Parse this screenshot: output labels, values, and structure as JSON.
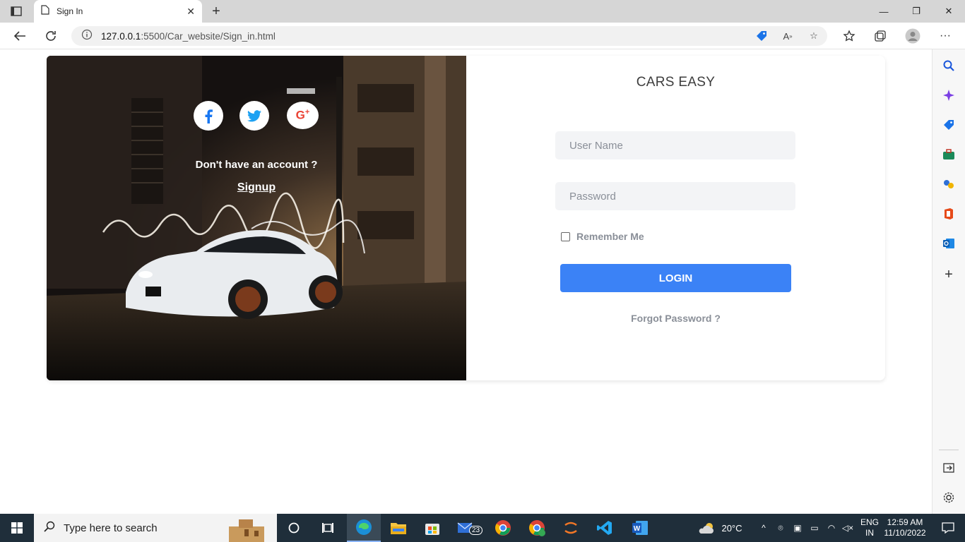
{
  "browser": {
    "tab_title": "Sign In",
    "url_host": "127.0.0.1",
    "url_path": ":5500/Car_website/Sign_in.html",
    "new_tab_label": "+"
  },
  "hero": {
    "no_account_text": "Don't have an account ?",
    "signup_link": "Signup",
    "social": [
      {
        "name": "facebook-icon",
        "glyph": "f",
        "color": "#1877f2"
      },
      {
        "name": "twitter-icon",
        "glyph": "t",
        "color": "#1da1f2"
      },
      {
        "name": "google-plus-icon",
        "glyph": "G+",
        "color": "#ea4335"
      }
    ]
  },
  "form": {
    "brand": "CARS EASY",
    "username_placeholder": "User Name",
    "password_placeholder": "Password",
    "remember_label": "Remember Me",
    "login_label": "LOGIN",
    "forgot_link": "Forgot Password ?"
  },
  "taskbar": {
    "search_placeholder": "Type here to search",
    "mail_badge": "23",
    "weather": "20°C",
    "lang_top": "ENG",
    "lang_bottom": "IN",
    "time": "12:59 AM",
    "date": "11/10/2022"
  },
  "colors": {
    "accent": "#3b82f6",
    "taskbar": "#1f2e3a"
  }
}
